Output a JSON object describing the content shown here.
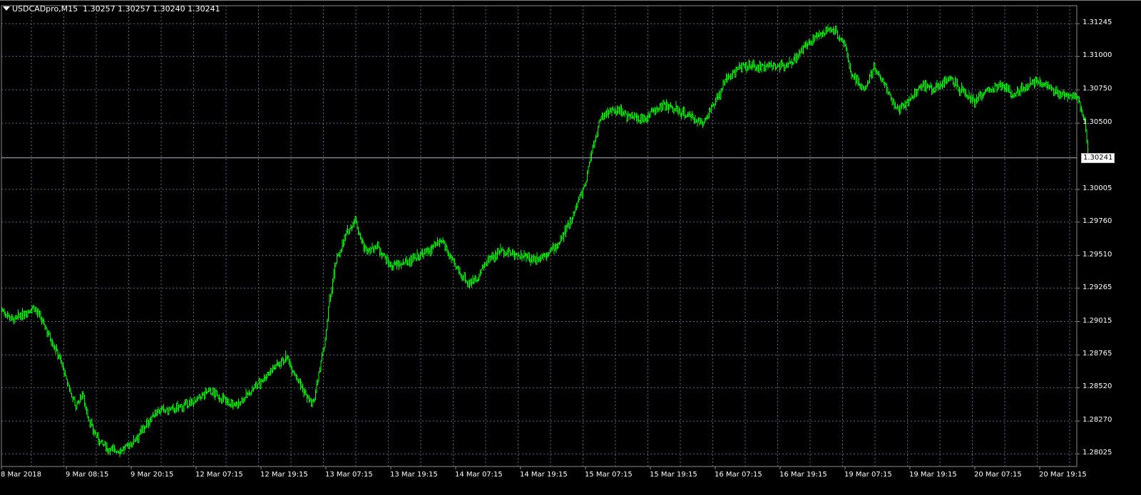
{
  "header": {
    "symbol_period": "USDCADpro,M15",
    "ohlc": "1.30257 1.30257 1.30240 1.30241",
    "toggle_icon": "triangle-down-icon"
  },
  "bid": {
    "label": "1.30241",
    "value": 1.30241
  },
  "colors": {
    "background": "#000000",
    "candles": "#00ff00",
    "grid": "#5a6a7a",
    "axis_text": "#ffffff",
    "bid_line": "#a8b4c0"
  },
  "chart_data": {
    "type": "line",
    "style": "ohlc-bars",
    "title": "USDCADpro,M15",
    "grid": true,
    "grid_style": "dotted",
    "price_axis_side": "right",
    "y_tick_labels": [
      "1.31245",
      "1.31000",
      "1.30750",
      "1.30500",
      "1.30005",
      "1.29760",
      "1.29510",
      "1.29265",
      "1.29015",
      "1.28765",
      "1.28520",
      "1.28270",
      "1.28025"
    ],
    "y_tick_values": [
      1.31245,
      1.31,
      1.3075,
      1.305,
      1.30005,
      1.2976,
      1.2951,
      1.29265,
      1.29015,
      1.28765,
      1.2852,
      1.2827,
      1.28025
    ],
    "ylim": [
      1.2793,
      1.3138
    ],
    "x_tick_labels": [
      "8 Mar 2018",
      "9 Mar 08:15",
      "9 Mar 20:15",
      "12 Mar 07:15",
      "12 Mar 19:15",
      "13 Mar 07:15",
      "13 Mar 19:15",
      "14 Mar 07:15",
      "14 Mar 19:15",
      "15 Mar 07:15",
      "15 Mar 19:15",
      "16 Mar 07:15",
      "16 Mar 19:15",
      "19 Mar 07:15",
      "19 Mar 19:15",
      "20 Mar 07:15",
      "20 Mar 19:15"
    ],
    "series": [
      {
        "x": [
          0,
          0.2,
          0.35,
          0.5,
          0.65,
          0.8,
          0.9,
          1,
          1.15,
          1.25,
          1.35,
          1.5,
          1.65,
          1.8,
          1.9,
          2,
          2.2,
          2.4,
          2.6,
          2.8,
          3,
          3.2,
          3.4,
          3.6,
          3.8,
          4,
          4.2,
          4.4,
          4.6,
          4.8,
          5,
          5.05,
          5.15,
          5.3,
          5.45,
          5.6,
          5.8,
          5.9,
          6,
          6.2,
          6.4,
          6.6,
          6.8,
          7,
          7.2,
          7.35,
          7.5,
          7.7,
          7.9,
          8,
          8.2,
          8.4,
          8.6,
          8.8,
          9,
          9.1,
          9.25,
          9.4,
          9.55,
          9.7,
          9.9,
          10,
          10.2,
          10.4,
          10.6,
          10.8,
          11,
          11.2,
          11.4,
          11.6,
          11.8,
          12,
          12.2,
          12.4,
          12.6,
          12.8,
          13,
          13.1,
          13.3,
          13.45,
          13.6,
          13.8,
          14,
          14.2,
          14.4,
          14.6,
          14.8,
          15,
          15.2,
          15.4,
          15.6,
          15.8,
          16,
          16.2,
          16.4,
          16.6,
          16.7,
          16.75
        ],
        "y": [
          1.2911,
          1.2902,
          1.2908,
          1.2912,
          1.29,
          1.2885,
          1.2875,
          1.2858,
          1.2838,
          1.2848,
          1.2828,
          1.2812,
          1.2806,
          1.2805,
          1.2806,
          1.281,
          1.2822,
          1.2835,
          1.2835,
          1.2838,
          1.2842,
          1.285,
          1.2844,
          1.2838,
          1.2847,
          1.2857,
          1.2867,
          1.2875,
          1.2855,
          1.2838,
          1.289,
          1.2915,
          1.2945,
          1.2965,
          1.2978,
          1.2955,
          1.2958,
          1.295,
          1.2943,
          1.2945,
          1.295,
          1.2955,
          1.2962,
          1.2942,
          1.293,
          1.2935,
          1.2948,
          1.2955,
          1.2952,
          1.2951,
          1.2948,
          1.2952,
          1.296,
          1.298,
          1.3005,
          1.303,
          1.3055,
          1.306,
          1.3058,
          1.3055,
          1.3052,
          1.3058,
          1.3064,
          1.306,
          1.3055,
          1.305,
          1.3065,
          1.3085,
          1.3093,
          1.3092,
          1.3092,
          1.3093,
          1.3097,
          1.3108,
          1.3116,
          1.3121,
          1.311,
          1.3085,
          1.3075,
          1.3092,
          1.308,
          1.306,
          1.3068,
          1.3078,
          1.3076,
          1.3084,
          1.3074,
          1.3067,
          1.3074,
          1.3079,
          1.3072,
          1.3078,
          1.3082,
          1.3074,
          1.3072,
          1.307,
          1.305,
          1.3024
        ]
      }
    ]
  }
}
